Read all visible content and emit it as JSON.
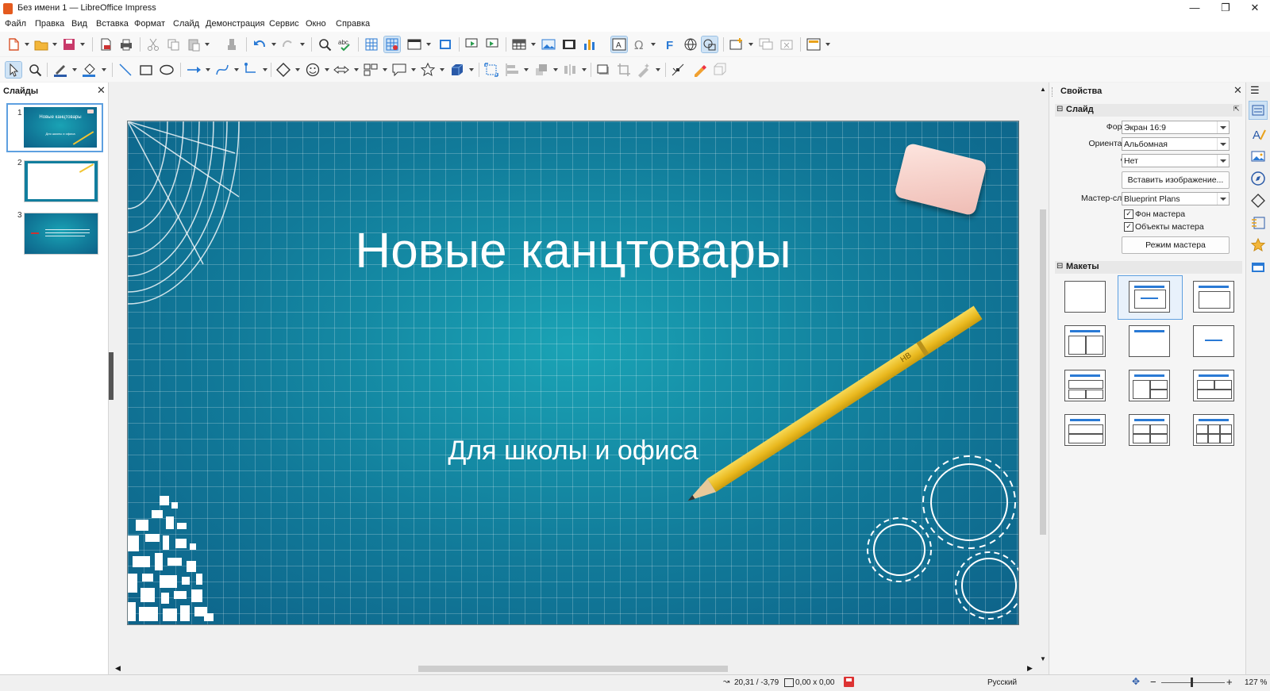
{
  "window": {
    "title": "Без имени 1 — LibreOffice Impress",
    "controls": [
      "minimize-icon",
      "restore-icon",
      "close-icon"
    ]
  },
  "menu": [
    "Файл",
    "Правка",
    "Вид",
    "Вставка",
    "Формат",
    "Слайд",
    "Демонстрация",
    "Сервис",
    "Окно",
    "Справка"
  ],
  "slides_panel": {
    "title": "Слайды",
    "thumbnails": [
      {
        "number": "1",
        "title": "Новые канцтовары",
        "subtitle": "Для школы и офиса"
      },
      {
        "number": "2"
      },
      {
        "number": "3"
      }
    ]
  },
  "slide": {
    "title": "Новые канцтовары",
    "subtitle": "Для школы и офиса",
    "pencil_text": "HB"
  },
  "properties": {
    "panel_title": "Свойства",
    "section_slide": "Слайд",
    "format_label": "Формат:",
    "format_value": "Экран 16:9",
    "orientation_label": "Ориентация:",
    "orientation_value": "Альбомная",
    "background_label": "Фон:",
    "background_value": "Нет",
    "insert_image_button": "Вставить изображение...",
    "master_slide_label": "Мастер-слайд:",
    "master_slide_value": "Blueprint Plans",
    "master_background_label": "Фон мастера",
    "master_background_checked": true,
    "master_objects_label": "Объекты мастера",
    "master_objects_checked": true,
    "master_mode_button": "Режим мастера",
    "section_layouts": "Макеты"
  },
  "status": {
    "position": "20,31 / -3,79",
    "size": "0,00 x 0,00",
    "language": "Русский",
    "zoom": "127 %"
  },
  "colors": {
    "slide_bg": "#117a99",
    "accent": "#2a7ad5",
    "pencil": "#f2c531",
    "eraser": "#f6d5d0"
  }
}
